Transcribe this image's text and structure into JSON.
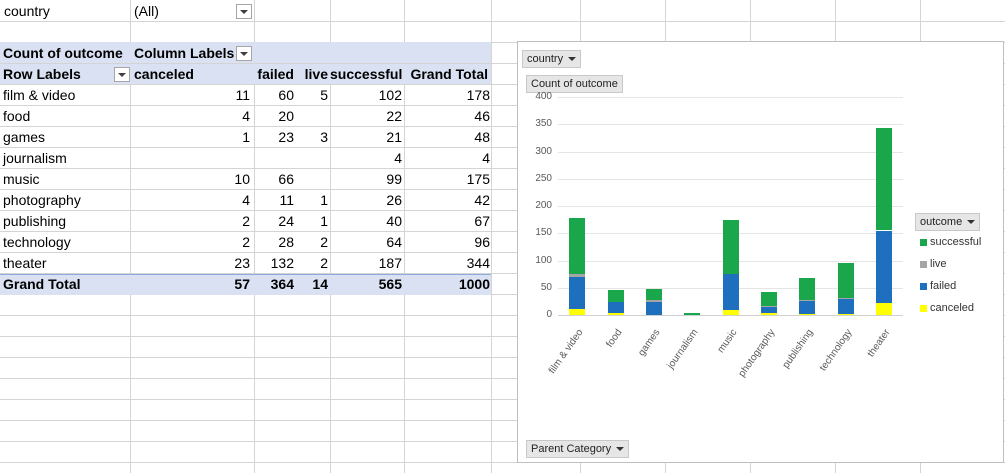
{
  "filter": {
    "label": "country",
    "value": "(All)"
  },
  "pivot": {
    "title": "Count of outcome",
    "column_labels": "Column Labels",
    "row_labels": "Row Labels",
    "columns": [
      "canceled",
      "failed",
      "live",
      "successful",
      "Grand Total"
    ],
    "rows": [
      {
        "label": "film & video",
        "values": [
          "11",
          "60",
          "5",
          "102",
          "178"
        ]
      },
      {
        "label": "food",
        "values": [
          "4",
          "20",
          "",
          "22",
          "46"
        ]
      },
      {
        "label": "games",
        "values": [
          "1",
          "23",
          "3",
          "21",
          "48"
        ]
      },
      {
        "label": "journalism",
        "values": [
          "",
          "",
          "",
          "4",
          "4"
        ]
      },
      {
        "label": "music",
        "values": [
          "10",
          "66",
          "",
          "99",
          "175"
        ]
      },
      {
        "label": "photography",
        "values": [
          "4",
          "11",
          "1",
          "26",
          "42"
        ]
      },
      {
        "label": "publishing",
        "values": [
          "2",
          "24",
          "1",
          "40",
          "67"
        ]
      },
      {
        "label": "technology",
        "values": [
          "2",
          "28",
          "2",
          "64",
          "96"
        ]
      },
      {
        "label": "theater",
        "values": [
          "23",
          "132",
          "2",
          "187",
          "344"
        ]
      }
    ],
    "grand_total": {
      "label": "Grand Total",
      "values": [
        "57",
        "364",
        "14",
        "565",
        "1000"
      ]
    }
  },
  "chart": {
    "filter_chip": "country",
    "value_chip": "Count of outcome",
    "axis_chip": "Parent Category",
    "legend_title": "outcome",
    "legend": [
      {
        "name": "successful",
        "color": "#1aa64a"
      },
      {
        "name": "live",
        "color": "#a5a5a5"
      },
      {
        "name": "failed",
        "color": "#1f6fbf"
      },
      {
        "name": "canceled",
        "color": "#ffff00"
      }
    ]
  },
  "chart_data": {
    "type": "bar",
    "stacked": true,
    "categories": [
      "film & video",
      "food",
      "games",
      "journalism",
      "music",
      "photography",
      "publishing",
      "technology",
      "theater"
    ],
    "series": [
      {
        "name": "canceled",
        "values": [
          11,
          4,
          1,
          0,
          10,
          4,
          2,
          2,
          23
        ],
        "color": "#ffff00"
      },
      {
        "name": "failed",
        "values": [
          60,
          20,
          23,
          0,
          66,
          11,
          24,
          28,
          132
        ],
        "color": "#1f6fbf"
      },
      {
        "name": "live",
        "values": [
          5,
          0,
          3,
          0,
          0,
          1,
          1,
          2,
          2
        ],
        "color": "#a5a5a5"
      },
      {
        "name": "successful",
        "values": [
          102,
          22,
          21,
          4,
          99,
          26,
          40,
          64,
          187
        ],
        "color": "#1aa64a"
      }
    ],
    "ylim": [
      0,
      400
    ],
    "yticks": [
      0,
      50,
      100,
      150,
      200,
      250,
      300,
      350,
      400
    ],
    "grid": true,
    "legend_position": "right"
  }
}
